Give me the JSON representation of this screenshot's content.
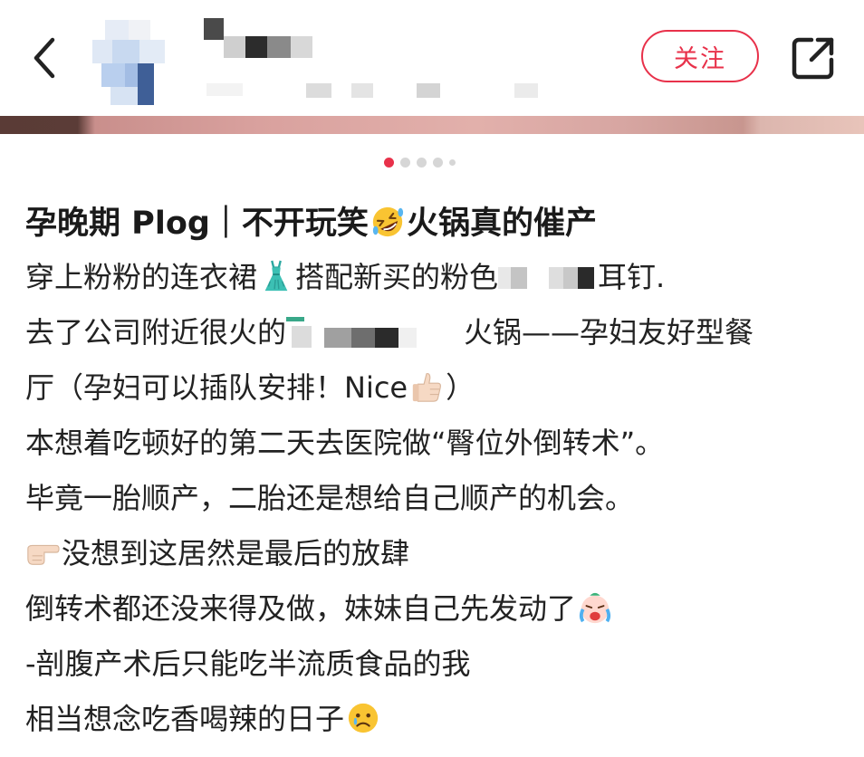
{
  "header": {
    "follow_label": "关注"
  },
  "post": {
    "title_a": "孕晚期 Plog｜不开玩笑",
    "title_b": "火锅真的催产",
    "lines": [
      "穿上粉粉的连衣裙",
      "搭配新买的粉色",
      "耳钉.",
      "去了公司附近很火的",
      "火锅——孕妇友好型餐",
      "厅（孕妇可以插队安排！Nice",
      "）",
      "本想着吃顿好的第二天去医院做“臀位外倒转术”。",
      "毕竟一胎顺产，二胎还是想给自己顺产的机会。",
      "没想到这居然是最后的放肆",
      "倒转术都还没来得及做，妹妹自己先发动了",
      "-剖腹产术后只能吃半流质食品的我",
      "相当想念吃香喝辣的日子"
    ]
  },
  "carousel": {
    "count": 5,
    "active": 0
  },
  "colors": {
    "accent": "#e8314a",
    "text": "#1f1f1f"
  },
  "icons": [
    "back-arrow-icon",
    "share-icon",
    "rofl-emoji-icon",
    "dress-emoji-icon",
    "thumbs-up-emoji-icon",
    "pointing-right-emoji-icon",
    "crying-emoji-icon",
    "sad-emoji-icon"
  ]
}
